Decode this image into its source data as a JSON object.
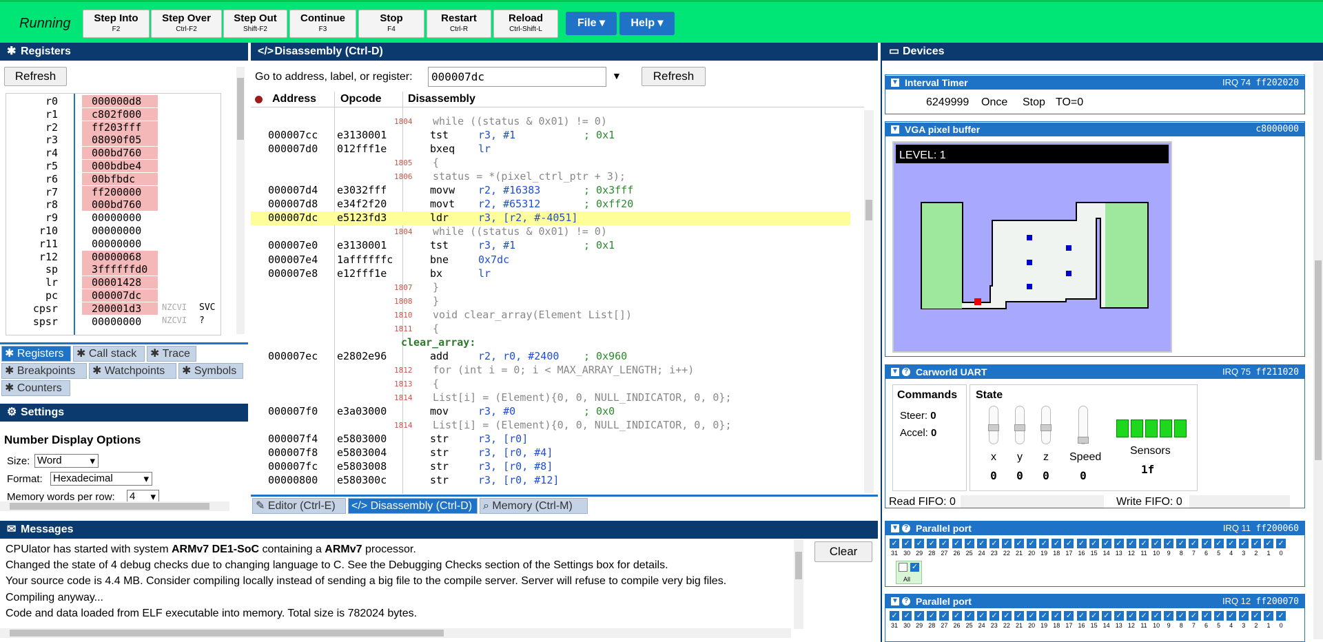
{
  "toolbar": {
    "status": "Running",
    "buttons": [
      {
        "label": "Step Into",
        "key": "F2"
      },
      {
        "label": "Step Over",
        "key": "Ctrl-F2"
      },
      {
        "label": "Step Out",
        "key": "Shift-F2"
      },
      {
        "label": "Continue",
        "key": "F3"
      },
      {
        "label": "Stop",
        "key": "F4"
      },
      {
        "label": "Restart",
        "key": "Ctrl-R"
      },
      {
        "label": "Reload",
        "key": "Ctrl-Shift-L"
      }
    ],
    "file_label": "File",
    "help_label": "Help"
  },
  "registers": {
    "title": "Registers",
    "refresh_label": "Refresh",
    "rows": [
      {
        "name": "r0",
        "value": "000000d8",
        "changed": true
      },
      {
        "name": "r1",
        "value": "c802f000",
        "changed": true
      },
      {
        "name": "r2",
        "value": "ff203fff",
        "changed": true
      },
      {
        "name": "r3",
        "value": "08090f05",
        "changed": true
      },
      {
        "name": "r4",
        "value": "000bd760",
        "changed": true
      },
      {
        "name": "r5",
        "value": "000bdbe4",
        "changed": true
      },
      {
        "name": "r6",
        "value": "00bfbdc",
        "changed": true
      },
      {
        "name": "r7",
        "value": "ff200000",
        "changed": true
      },
      {
        "name": "r8",
        "value": "000bd760",
        "changed": true
      },
      {
        "name": "r9",
        "value": "00000000",
        "changed": false
      },
      {
        "name": "r10",
        "value": "00000000",
        "changed": false
      },
      {
        "name": "r11",
        "value": "00000000",
        "changed": false
      },
      {
        "name": "r12",
        "value": "00000068",
        "changed": true
      },
      {
        "name": "sp",
        "value": "3ffffffd0",
        "changed": true
      },
      {
        "name": "lr",
        "value": "00001428",
        "changed": true
      },
      {
        "name": "pc",
        "value": "000007dc",
        "changed": true
      }
    ],
    "cpsr": {
      "name": "cpsr",
      "value": "200001d3",
      "flags": "NZCVI",
      "mode": "SVC"
    },
    "spsr": {
      "name": "spsr",
      "value": "00000000",
      "flags": "NZCVI",
      "mode": "?"
    }
  },
  "left_tabs": [
    "Registers",
    "Call stack",
    "Trace",
    "Breakpoints",
    "Watchpoints",
    "Symbols",
    "Counters"
  ],
  "settings": {
    "title": "Settings",
    "section": "Number Display Options",
    "size_label": "Size:",
    "size_value": "Word",
    "format_label": "Format:",
    "format_value": "Hexadecimal",
    "words_label": "Memory words per row:",
    "words_value": "4"
  },
  "disassembly": {
    "title": "Disassembly (Ctrl-D)",
    "goto_label": "Go to address, label, or register:",
    "goto_value": "000007dc",
    "refresh_label": "Refresh",
    "col_address": "Address",
    "col_opcode": "Opcode",
    "col_disassembly": "Disassembly",
    "lines": [
      {
        "kind": "src",
        "ln": "1804",
        "text": "while ((status & 0x01) != 0)"
      },
      {
        "kind": "ins",
        "addr": "000007cc",
        "op": "e3130001",
        "mn": "tst",
        "args": "r3, #1",
        "cm": "; 0x1"
      },
      {
        "kind": "ins",
        "addr": "000007d0",
        "op": "012fff1e",
        "mn": "bxeq",
        "args": "lr",
        "cm": ""
      },
      {
        "kind": "src",
        "ln": "1805",
        "text": "{"
      },
      {
        "kind": "src",
        "ln": "1806",
        "text": "status = *(pixel_ctrl_ptr + 3);"
      },
      {
        "kind": "ins",
        "addr": "000007d4",
        "op": "e3032fff",
        "mn": "movw",
        "args": "r2, #16383",
        "cm": "; 0x3fff"
      },
      {
        "kind": "ins",
        "addr": "000007d8",
        "op": "e34f2f20",
        "mn": "movt",
        "args": "r2, #65312",
        "cm": "; 0xff20"
      },
      {
        "kind": "cur",
        "addr": "000007dc",
        "op": "e5123fd3",
        "mn": "ldr",
        "args": "r3, [r2, #-4051]",
        "cm": ""
      },
      {
        "kind": "src",
        "ln": "1804",
        "text": "while ((status & 0x01) != 0)"
      },
      {
        "kind": "ins",
        "addr": "000007e0",
        "op": "e3130001",
        "mn": "tst",
        "args": "r3, #1",
        "cm": "; 0x1"
      },
      {
        "kind": "ins",
        "addr": "000007e4",
        "op": "1affffffc",
        "mn": "bne",
        "args": "0x7dc",
        "cm": ""
      },
      {
        "kind": "ins",
        "addr": "000007e8",
        "op": "e12fff1e",
        "mn": "bx",
        "args": "lr",
        "cm": ""
      },
      {
        "kind": "src",
        "ln": "1807",
        "text": "}"
      },
      {
        "kind": "src",
        "ln": "1808",
        "text": "}"
      },
      {
        "kind": "src",
        "ln": "1810",
        "text": "void clear_array(Element List[])"
      },
      {
        "kind": "src",
        "ln": "1811",
        "text": "{"
      },
      {
        "kind": "label",
        "text": "clear_array:"
      },
      {
        "kind": "ins",
        "addr": "000007ec",
        "op": "e2802e96",
        "mn": "add",
        "args": "r2, r0, #2400",
        "cm": "; 0x960"
      },
      {
        "kind": "src",
        "ln": "1812",
        "text": "for (int i = 0; i < MAX_ARRAY_LENGTH; i++)"
      },
      {
        "kind": "src",
        "ln": "1813",
        "text": "{"
      },
      {
        "kind": "src",
        "ln": "1814",
        "text": "List[i] = (Element){0, 0, NULL_INDICATOR, 0, 0};"
      },
      {
        "kind": "ins",
        "addr": "000007f0",
        "op": "e3a03000",
        "mn": "mov",
        "args": "r3, #0",
        "cm": "; 0x0"
      },
      {
        "kind": "src",
        "ln": "1814",
        "text": "List[i] = (Element){0, 0, NULL_INDICATOR, 0, 0};"
      },
      {
        "kind": "ins",
        "addr": "000007f4",
        "op": "e5803000",
        "mn": "str",
        "args": "r3, [r0]",
        "cm": ""
      },
      {
        "kind": "ins",
        "addr": "000007f8",
        "op": "e5803004",
        "mn": "str",
        "args": "r3, [r0, #4]",
        "cm": ""
      },
      {
        "kind": "ins",
        "addr": "000007fc",
        "op": "e5803008",
        "mn": "str",
        "args": "r3, [r0, #8]",
        "cm": ""
      },
      {
        "kind": "ins",
        "addr": "00000800",
        "op": "e580300c",
        "mn": "str",
        "args": "r3, [r0, #12]",
        "cm": ""
      }
    ],
    "tabs": [
      "Editor (Ctrl-E)",
      "Disassembly (Ctrl-D)",
      "Memory (Ctrl-M)"
    ]
  },
  "devices": {
    "title": "Devices",
    "interval_timer": {
      "title": "Interval Timer",
      "irq": "IRQ 74",
      "addr": "ff202020",
      "count": "6249999",
      "mode": "Once",
      "state": "Stop",
      "to": "TO=0"
    },
    "vga": {
      "title": "VGA pixel buffer",
      "addr": "c8000000",
      "level_text": "LEVEL: 1"
    },
    "uart": {
      "title": "Carworld UART",
      "irq": "IRQ 75",
      "addr": "ff211020",
      "commands_title": "Commands",
      "steer_label": "Steer:",
      "steer_value": "0",
      "accel_label": "Accel:",
      "accel_value": "0",
      "state_title": "State",
      "state_cols": [
        {
          "label": "x",
          "value": "0",
          "level": 0.5
        },
        {
          "label": "y",
          "value": "0",
          "level": 0.5
        },
        {
          "label": "z",
          "value": "0",
          "level": 0.5
        },
        {
          "label": "Speed",
          "value": "0",
          "level": 0.0
        }
      ],
      "sensors_label": "Sensors",
      "sensors_value": "1f",
      "read_fifo": "Read FIFO: 0",
      "write_fifo": "Write FIFO: 0"
    },
    "parallel1": {
      "title": "Parallel port",
      "irq": "IRQ 11",
      "addr": "ff200060",
      "all_label": "All"
    },
    "parallel2": {
      "title": "Parallel port",
      "irq": "IRQ 12",
      "addr": "ff200070"
    },
    "bit_labels": [
      "31",
      "30",
      "29",
      "28",
      "27",
      "26",
      "25",
      "24",
      "23",
      "22",
      "21",
      "20",
      "19",
      "18",
      "17",
      "16",
      "15",
      "14",
      "13",
      "12",
      "11",
      "10",
      "9",
      "8",
      "7",
      "6",
      "5",
      "4",
      "3",
      "2",
      "1",
      "0"
    ],
    "check_glyph": "✓"
  },
  "messages": {
    "title": "Messages",
    "clear_label": "Clear",
    "lines": [
      {
        "pre": "CPUlator has started with system ",
        "b1": "ARMv7 DE1-SoC",
        "mid": " containing a ",
        "b2": "ARMv7",
        "post": " processor."
      },
      {
        "pre": "Changed the state of 4 debug checks due to changing language to C. See the Debugging Checks section of the Settings box for details.",
        "b1": "",
        "mid": "",
        "b2": "",
        "post": ""
      },
      {
        "pre": "Your source code is 4.4 MB. Consider compiling locally instead of sending a big file to the compile server. Server will refuse to compile very big files.",
        "b1": "",
        "mid": "",
        "b2": "",
        "post": ""
      },
      {
        "pre": "Compiling anyway...",
        "b1": "",
        "mid": "",
        "b2": "",
        "post": ""
      },
      {
        "pre": "Code and data loaded from ELF executable into memory. Total size is 782024 bytes.",
        "b1": "",
        "mid": "",
        "b2": "",
        "post": ""
      }
    ]
  }
}
